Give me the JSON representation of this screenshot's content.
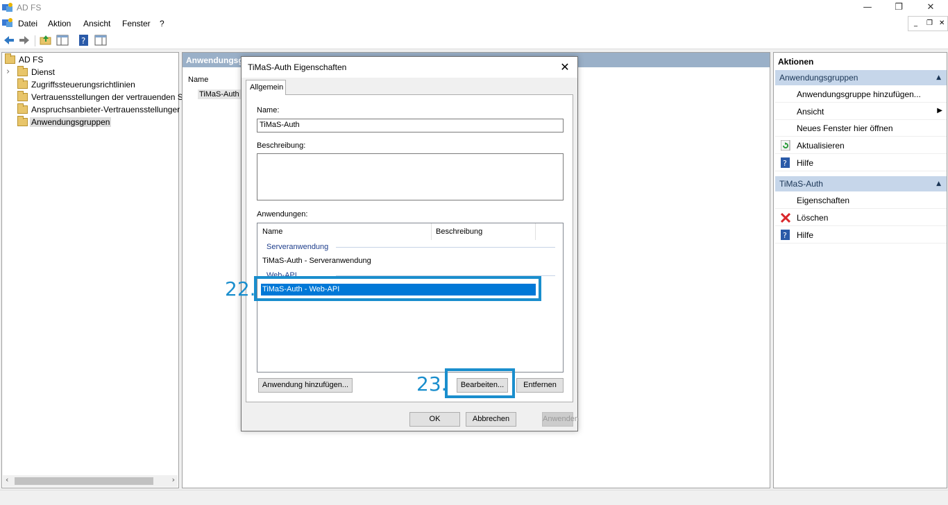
{
  "window": {
    "title": "AD FS",
    "minimize_glyph": "—",
    "restore_glyph": "❐",
    "close_glyph": "✕"
  },
  "menu": {
    "items": [
      "Datei",
      "Aktion",
      "Ansicht",
      "Fenster",
      "?"
    ],
    "mdi_minimize": "_",
    "mdi_restore": "❐",
    "mdi_close": "✕"
  },
  "toolbar": {
    "icons": [
      "back-arrow-icon",
      "forward-arrow-icon",
      "up-folder-icon",
      "show-hide-tree-icon",
      "help-icon",
      "show-hide-actions-icon"
    ]
  },
  "tree": {
    "root": "AD FS",
    "expand_glyph": "›",
    "items": [
      {
        "label": "Dienst"
      },
      {
        "label": "Zugriffssteuerungsrichtlinien"
      },
      {
        "label": "Vertrauensstellungen der vertrauenden S"
      },
      {
        "label": "Anspruchsanbieter-Vertrauensstellunger"
      },
      {
        "label": "Anwendungsgruppen",
        "selected": true
      }
    ],
    "scroll_left": "‹",
    "scroll_right": "›"
  },
  "center": {
    "header": "Anwendungsg",
    "column_name": "Name",
    "row": "TiMaS-Auth"
  },
  "actions": {
    "title": "Aktionen",
    "group1": {
      "title": "Anwendungsgruppen",
      "collapse_glyph": "▲",
      "items": [
        {
          "label": "Anwendungsgruppe hinzufügen...",
          "icon": ""
        },
        {
          "label": "Ansicht",
          "icon": "",
          "submenu": "▶"
        },
        {
          "label": "Neues Fenster hier öffnen",
          "icon": ""
        },
        {
          "label": "Aktualisieren",
          "icon": "refresh-icon"
        },
        {
          "label": "Hilfe",
          "icon": "help-icon"
        }
      ]
    },
    "group2": {
      "title": "TiMaS-Auth",
      "collapse_glyph": "▲",
      "items": [
        {
          "label": "Eigenschaften",
          "icon": ""
        },
        {
          "label": "Löschen",
          "icon": "delete-icon"
        },
        {
          "label": "Hilfe",
          "icon": "help-icon"
        }
      ]
    }
  },
  "dialog": {
    "title": "TiMaS-Auth Eigenschaften",
    "close_glyph": "✕",
    "tab": "Allgemein",
    "name_label": "Name:",
    "name_value": "TiMaS-Auth",
    "description_label": "Beschreibung:",
    "description_value": "",
    "apps_label": "Anwendungen:",
    "col_name": "Name",
    "col_description": "Beschreibung",
    "group_server": "Serveranwendung",
    "row_server": "TiMaS-Auth - Serveranwendung",
    "group_webapi": "Web-API",
    "row_webapi": "TiMaS-Auth - Web-API",
    "btn_add": "Anwendung hinzufügen...",
    "btn_edit": "Bearbeiten...",
    "btn_remove": "Entfernen",
    "btn_ok": "OK",
    "btn_cancel": "Abbrechen",
    "btn_apply": "Anwenden"
  },
  "annotations": {
    "step22": "22.",
    "step23": "23.",
    "color": "#1a8ecd"
  }
}
